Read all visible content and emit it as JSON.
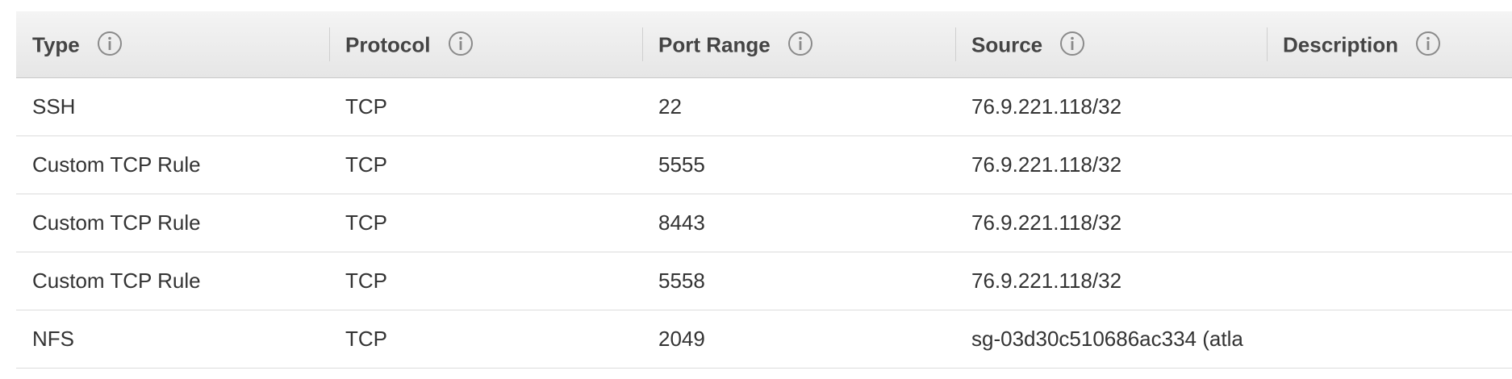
{
  "table": {
    "headers": [
      {
        "label": "Type"
      },
      {
        "label": "Protocol"
      },
      {
        "label": "Port Range"
      },
      {
        "label": "Source"
      },
      {
        "label": "Description"
      }
    ],
    "rows": [
      {
        "type": "SSH",
        "protocol": "TCP",
        "port_range": "22",
        "source": "76.9.221.118/32",
        "description": ""
      },
      {
        "type": "Custom TCP Rule",
        "protocol": "TCP",
        "port_range": "5555",
        "source": "76.9.221.118/32",
        "description": ""
      },
      {
        "type": "Custom TCP Rule",
        "protocol": "TCP",
        "port_range": "8443",
        "source": "76.9.221.118/32",
        "description": ""
      },
      {
        "type": "Custom TCP Rule",
        "protocol": "TCP",
        "port_range": "5558",
        "source": "76.9.221.118/32",
        "description": ""
      },
      {
        "type": "NFS",
        "protocol": "TCP",
        "port_range": "2049",
        "source": "sg-03d30c510686ac334 (atla",
        "description": ""
      }
    ]
  },
  "icons": {
    "header_info": "info-icon"
  },
  "colors": {
    "header_bg": "#ececec",
    "row_divider": "#dcdcdc",
    "text": "#333333",
    "icon_stroke": "#8a8a8a"
  }
}
